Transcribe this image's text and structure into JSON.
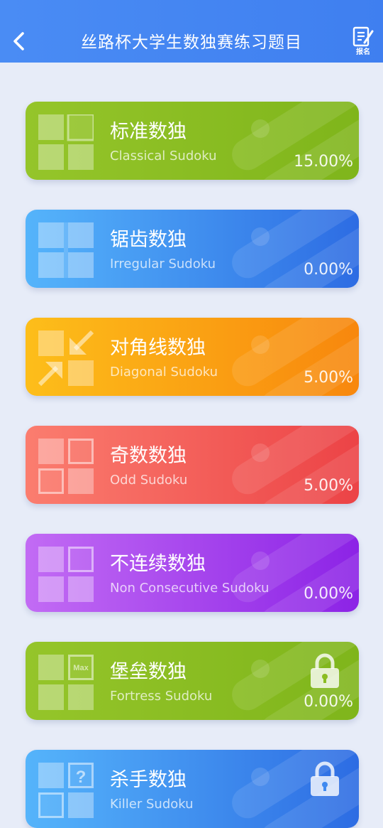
{
  "header": {
    "title": "丝路杯大学生数独赛练习题目",
    "signup_label": "报名"
  },
  "colors": {
    "header": "#4a8cf4",
    "background": "#e7ecf8",
    "green": "#8bbd22",
    "blue": "#3f8af0",
    "orange": "#fba413",
    "red": "#f45f5a",
    "purple": "#a845ec"
  },
  "cards": [
    {
      "title": "标准数独",
      "subtitle": "Classical Sudoku",
      "progress": "15.00%",
      "icon": "classical-grid-icon",
      "locked": false
    },
    {
      "title": "锯齿数独",
      "subtitle": "Irregular Sudoku",
      "progress": "0.00%",
      "icon": "irregular-grid-icon",
      "locked": false
    },
    {
      "title": "对角线数独",
      "subtitle": "Diagonal Sudoku",
      "progress": "5.00%",
      "icon": "diagonal-arrows-icon",
      "locked": false
    },
    {
      "title": "奇数数独",
      "subtitle": "Odd Sudoku",
      "progress": "5.00%",
      "icon": "odd-grid-icon",
      "locked": false
    },
    {
      "title": "不连续数独",
      "subtitle": "Non Consecutive Sudoku",
      "progress": "0.00%",
      "icon": "non-consecutive-grid-icon",
      "locked": false
    },
    {
      "title": "堡垒数独",
      "subtitle": "Fortress Sudoku",
      "progress": "0.00%",
      "icon": "fortress-max-icon",
      "icon_text": "Max",
      "locked": true
    },
    {
      "title": "杀手数独",
      "subtitle": "Killer Sudoku",
      "progress": "",
      "icon": "killer-question-icon",
      "icon_text": "?",
      "locked": true
    }
  ]
}
